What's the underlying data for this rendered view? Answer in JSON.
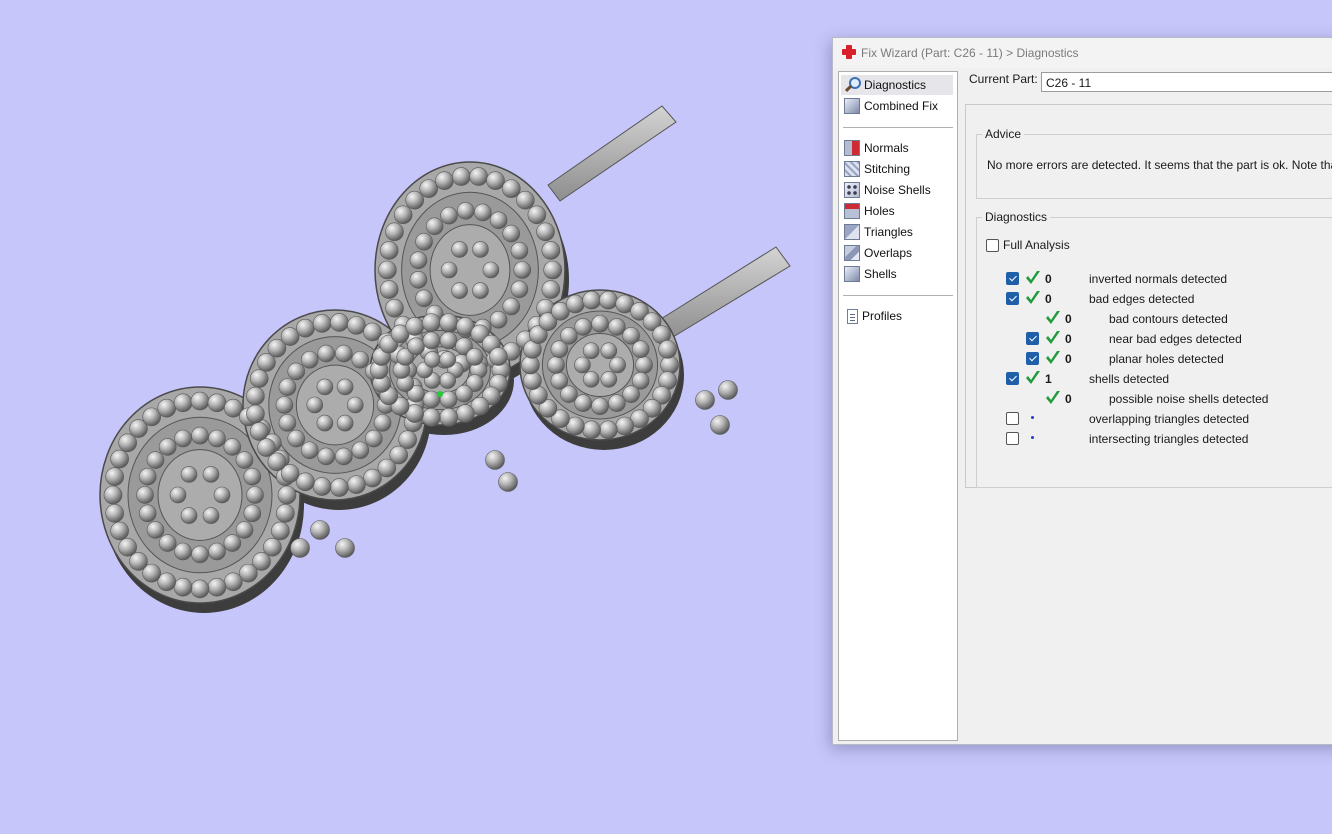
{
  "window": {
    "title": "Fix Wizard (Part: C26 - 11) > Diagnostics",
    "accent": "#1f5faa",
    "tick_color": "#1f9a3c"
  },
  "viewport": {
    "background": "#c6c6fa",
    "object": "3d-part-jewelry-model"
  },
  "nav": {
    "top_items": [
      {
        "label": "Diagnostics",
        "icon": "magnifier-icon",
        "selected": true
      },
      {
        "label": "Combined Fix",
        "icon": "combined-fix-icon"
      }
    ],
    "fix_items": [
      {
        "label": "Normals",
        "icon": "normals-icon"
      },
      {
        "label": "Stitching",
        "icon": "stitching-icon"
      },
      {
        "label": "Noise Shells",
        "icon": "noise-shells-icon"
      },
      {
        "label": "Holes",
        "icon": "holes-icon"
      },
      {
        "label": "Triangles",
        "icon": "triangles-icon"
      },
      {
        "label": "Overlaps",
        "icon": "overlaps-icon"
      },
      {
        "label": "Shells",
        "icon": "shells-icon"
      }
    ],
    "bottom_items": [
      {
        "label": "Profiles",
        "icon": "profiles-icon"
      }
    ]
  },
  "current_part": {
    "label": "Current Part:",
    "value": "C26 - 11"
  },
  "advice": {
    "legend": "Advice",
    "text": "No more errors are detected. It seems that the part is ok. Note that not"
  },
  "diagnostics": {
    "legend": "Diagnostics",
    "full_analysis": {
      "label": "Full Analysis",
      "checked": false
    },
    "rows": [
      {
        "checkbox": "checked",
        "tick": true,
        "count": "0",
        "label": "inverted normals detected",
        "indent": 0
      },
      {
        "checkbox": "checked",
        "tick": true,
        "count": "0",
        "label": "bad edges detected",
        "indent": 0
      },
      {
        "checkbox": "none",
        "tick": true,
        "count": "0",
        "label": "bad contours detected",
        "indent": 1
      },
      {
        "checkbox": "checked",
        "tick": true,
        "count": "0",
        "label": "near bad edges detected",
        "indent": 1
      },
      {
        "checkbox": "checked",
        "tick": true,
        "count": "0",
        "label": "planar holes detected",
        "indent": 1
      },
      {
        "checkbox": "checked",
        "tick": true,
        "count": "1",
        "label": "shells detected",
        "indent": 0
      },
      {
        "checkbox": "none",
        "tick": true,
        "count": "0",
        "label": "possible noise shells detected",
        "indent": 1
      },
      {
        "checkbox": "unchecked",
        "tick": false,
        "count": "",
        "label": "overlapping triangles detected",
        "indent": 0
      },
      {
        "checkbox": "unchecked",
        "tick": false,
        "count": "",
        "label": "intersecting triangles detected",
        "indent": 0
      }
    ]
  }
}
